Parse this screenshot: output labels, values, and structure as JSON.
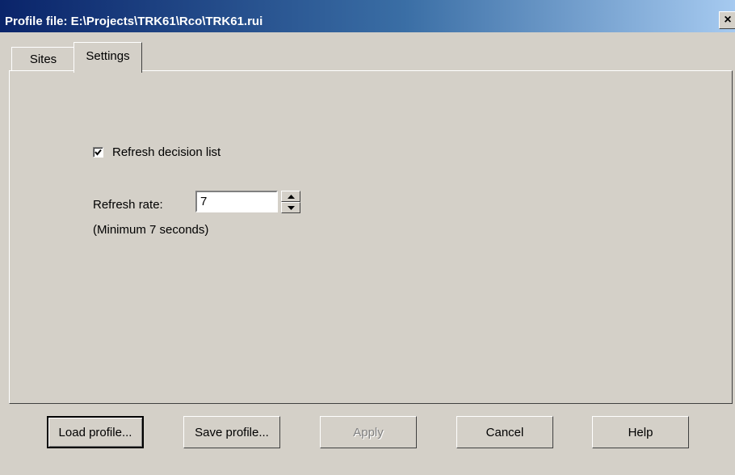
{
  "window": {
    "title": "Profile file: E:\\Projects\\TRK61\\Rco\\TRK61.rui",
    "close_label": "×"
  },
  "tabs": [
    {
      "label": "Sites",
      "active": false
    },
    {
      "label": "Settings",
      "active": true
    }
  ],
  "settings": {
    "refresh_checkbox": {
      "label": "Refresh decision list",
      "checked": true
    },
    "refresh_rate": {
      "label": "Refresh rate:",
      "value": "7"
    },
    "hint": "(Minimum 7 seconds)"
  },
  "buttons": {
    "load": "Load profile...",
    "save": "Save profile...",
    "apply": "Apply",
    "cancel": "Cancel",
    "help": "Help"
  },
  "colors": {
    "face": "#d4d0c8",
    "title_start": "#0a246a",
    "title_end": "#a6caf0"
  }
}
